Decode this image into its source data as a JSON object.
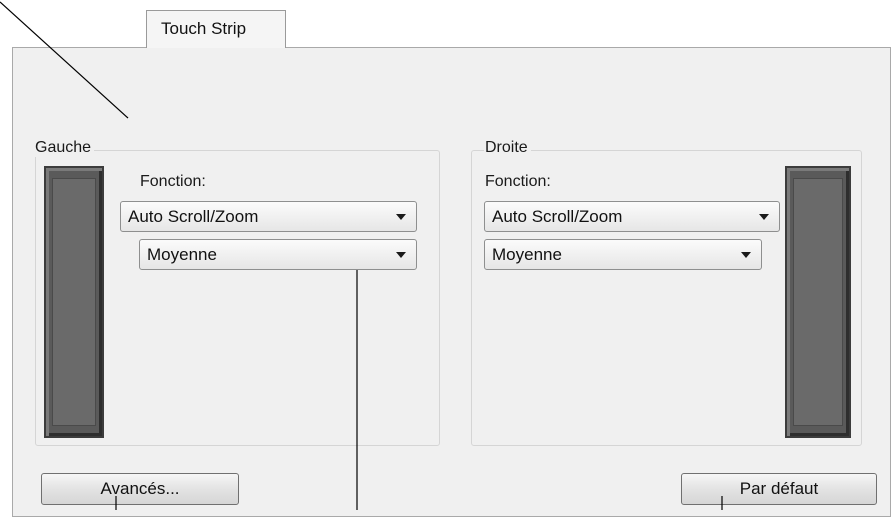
{
  "tab": {
    "label": "Touch Strip"
  },
  "left_group": {
    "legend": "Gauche",
    "function_label": "Fonction:",
    "function_value": "Auto Scroll/Zoom",
    "speed_value": "Moyenne"
  },
  "right_group": {
    "legend": "Droite",
    "function_label": "Fonction:",
    "function_value": "Auto Scroll/Zoom",
    "speed_value": "Moyenne"
  },
  "buttons": {
    "advanced": "Avancés...",
    "default": "Par défaut"
  },
  "icons": {
    "dropdown": "chevron-down-icon"
  }
}
